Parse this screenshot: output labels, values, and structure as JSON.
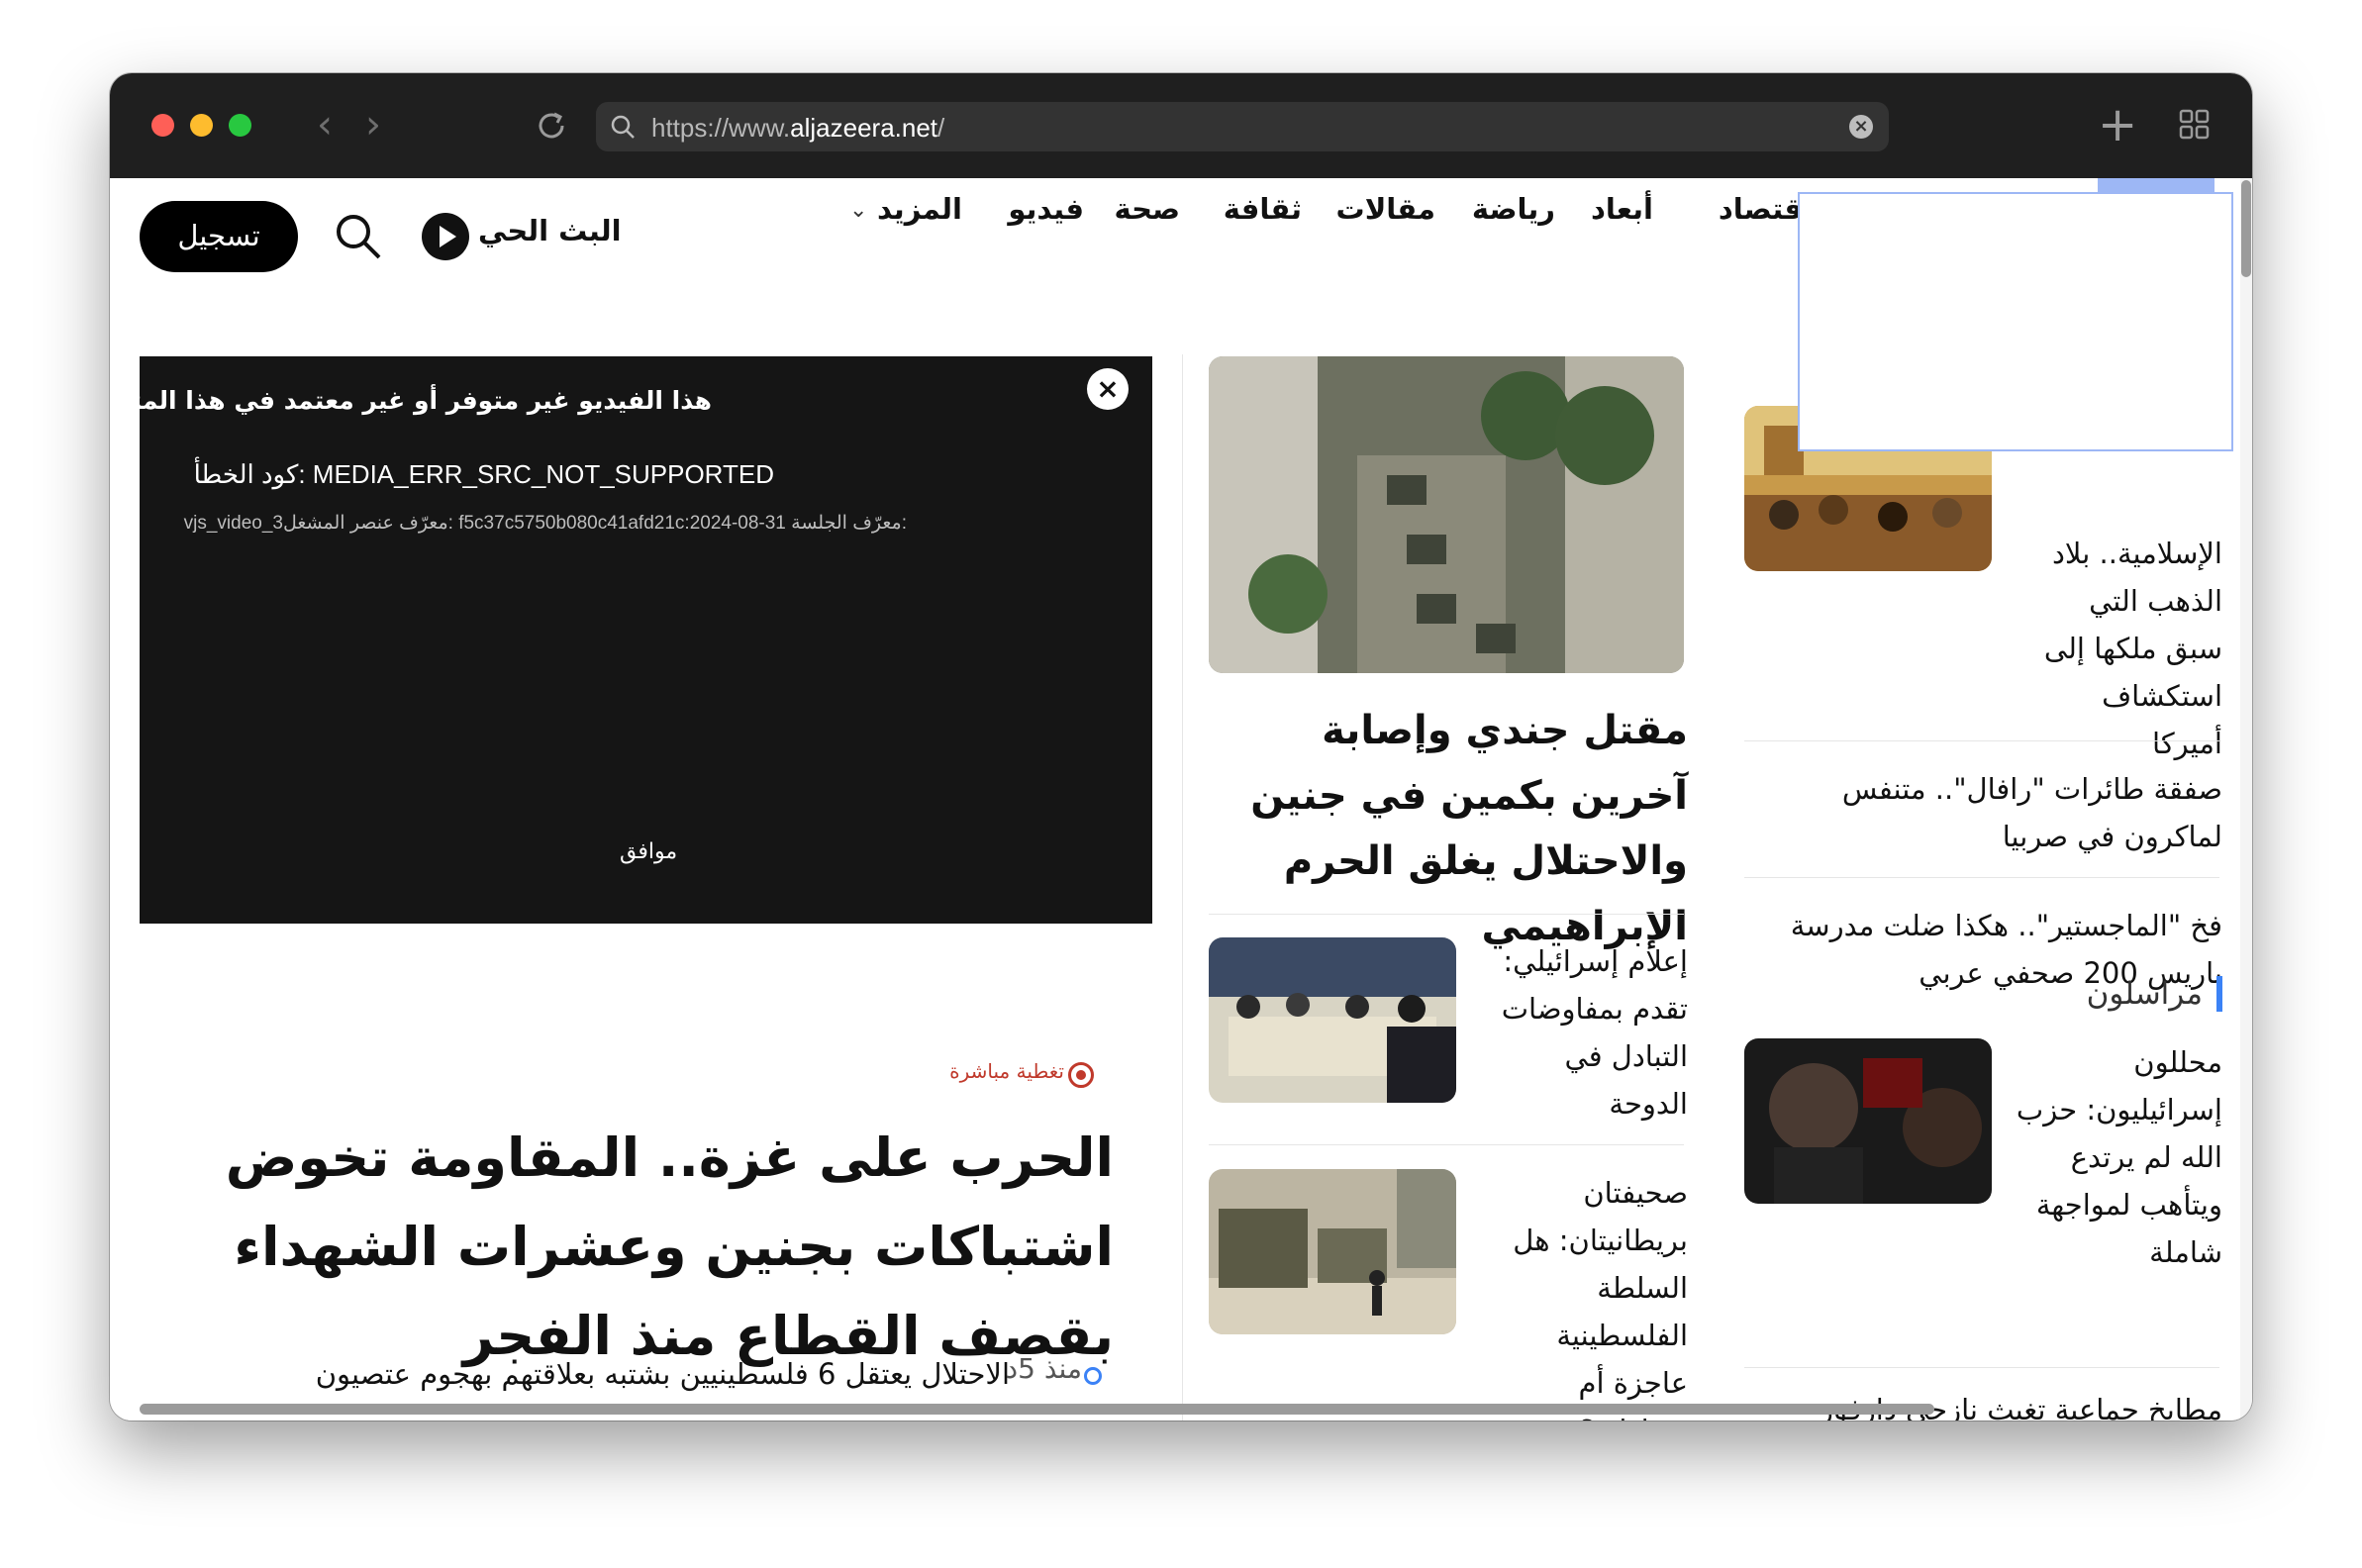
{
  "browser": {
    "url_prefix": "https://www.",
    "url_domain": "aljazeera.net",
    "url_suffix": "/"
  },
  "header": {
    "nav": [
      "اقتصاد",
      "أبعاد",
      "رياضة",
      "مقالات",
      "ثقافة",
      "صحة",
      "فيديو",
      "المزيد"
    ],
    "live_label": "البث الحي",
    "register_label": "تسجيل"
  },
  "player": {
    "title": "هذا الفيديو غير متوفر أو غير معتمد في هذا المتصفح",
    "code": "كود الخطأ: MEDIA_ERR_SRC_NOT_SUPPORTED",
    "ids": "vjs_video_3معرّف عنصر المشغل: f5c37c5750b080c41afd21c:2024-08-31 معرّف الجلسة:",
    "ok": "موافق"
  },
  "main": {
    "live_badge": "تغطية مباشرة",
    "headline": "الحرب على غزة.. المقاومة تخوض اشتباكات بجنين وعشرات الشهداء بقصف القطاع منذ الفجر",
    "ticker_time": "منذ 5د",
    "ticker_text": "الاحتلال يعتقل 6 فلسطينيين بشتبه بعلاقتهم بهجوم عتصيون"
  },
  "middle": {
    "lead_title": "مقتل جندي وإصابة آخرين بكمين في جنين والاحتلال يغلق الحرم الإبراهيمي",
    "items": [
      "إعلام إسرائيلي: تقدم بمفاوضات التبادل في الدوحة",
      "صحيفتان بريطانيتان: هل السلطة الفلسطينية عاجزة أم متواطئة؟"
    ]
  },
  "right": {
    "lead_text": "الإسلامية.. بلاد الذهب التي سبق ملكها إلى استكشاف أميركا",
    "items": [
      "صفقة طائرات \"رافال\".. متنفس لماكرون في صربيا",
      "فخ \"الماجستير\".. هكذا ضلت مدرسة باريس 200 صحفي عربي"
    ],
    "section_title": "مراسلون",
    "section_item": "محللون إسرائيليون: حزب الله لم يرتدع ويتأهب لمواجهة شاملة",
    "last_item": "مطابخ جماعية تغيث نازحي دارفور"
  }
}
